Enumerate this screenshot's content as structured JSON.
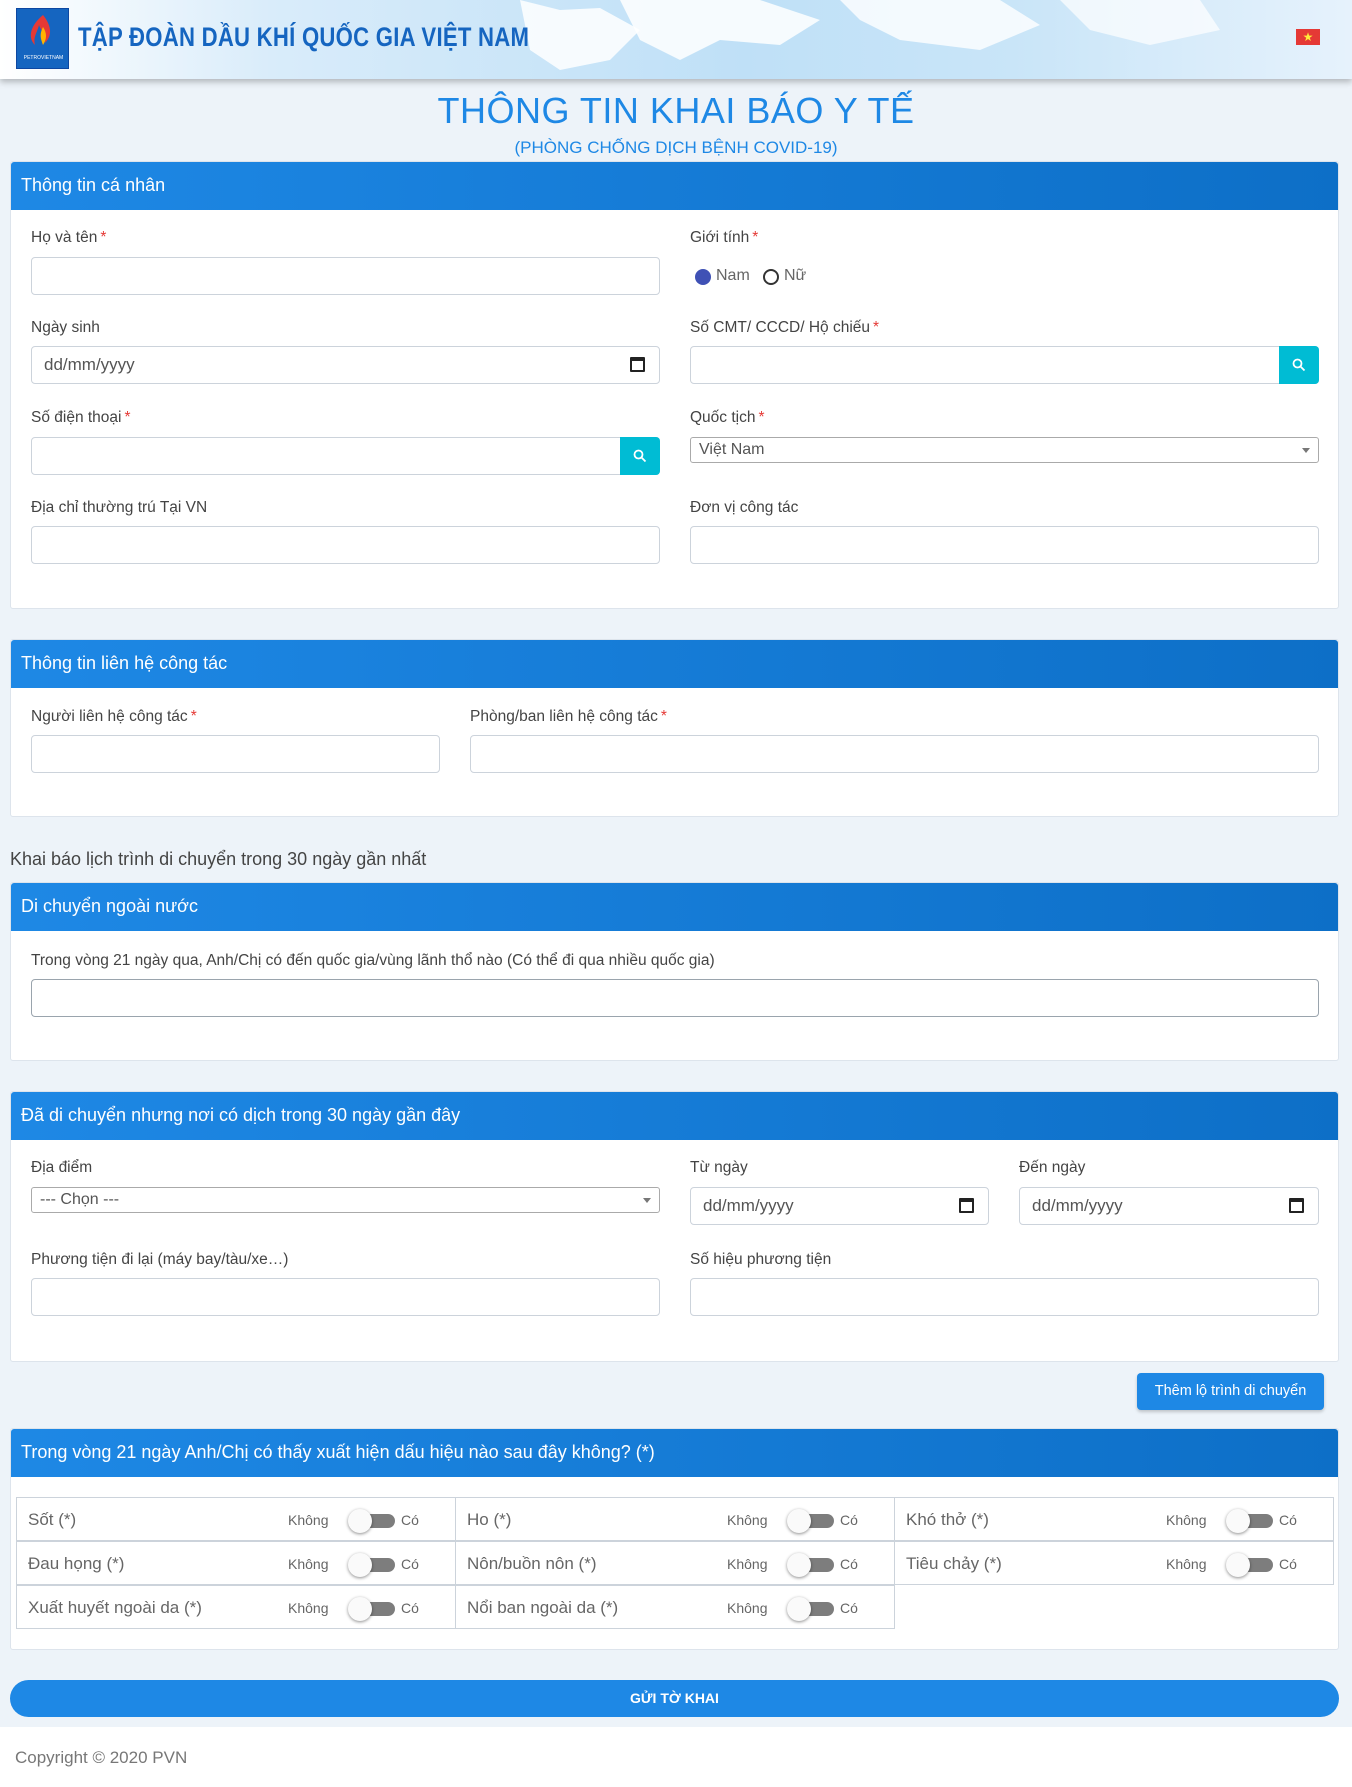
{
  "header": {
    "org_name": "TẬP ĐOÀN DẦU KHÍ QUỐC GIA VIỆT NAM",
    "logo_text": "PETROVIETNAM",
    "flag_icon": "vietnam-flag-icon"
  },
  "page": {
    "title": "THÔNG TIN KHAI BÁO Y TẾ",
    "subtitle": "(PHÒNG CHỐNG DỊCH BỆNH COVID-19)"
  },
  "personal": {
    "heading": "Thông tin cá nhân",
    "name_label": "Họ và tên",
    "gender_label": "Giới tính",
    "gender_male": "Nam",
    "gender_female": "Nữ",
    "gender_selected": "Nam",
    "dob_label": "Ngày sinh",
    "date_placeholder": "dd/mm/yyyy",
    "id_label": "Số CMT/ CCCD/ Hộ chiếu",
    "phone_label": "Số điện thoại",
    "nationality_label": "Quốc tịch",
    "nationality_value": "Việt Nam",
    "address_label": "Địa chỉ thường trú Tại VN",
    "workplace_label": "Đơn vị công tác",
    "required_mark": "*"
  },
  "contact": {
    "heading": "Thông tin liên hệ công tác",
    "person_label": "Người liên hệ công tác",
    "dept_label": "Phòng/ban liên hệ công tác"
  },
  "travel_note": "Khai báo lịch trình di chuyển trong 30 ngày gần nhất",
  "abroad": {
    "heading": "Di chuyển ngoài nước",
    "question": "Trong vòng 21 ngày qua, Anh/Chị có đến quốc gia/vùng lãnh thổ nào (Có thể đi qua nhiều quốc gia)"
  },
  "epidemic": {
    "heading": "Đã di chuyển nhưng nơi có dịch trong 30 ngày gần đây",
    "place_label": "Địa điểm",
    "place_value": "--- Chọn ---",
    "from_label": "Từ ngày",
    "to_label": "Đến ngày",
    "date_placeholder": "dd/mm/yyyy",
    "vehicle_label": "Phương tiện đi lại (máy bay/tàu/xe…)",
    "vehicle_no_label": "Số hiệu phương tiện",
    "add_button": "Thêm lộ trình di chuyển"
  },
  "symptoms": {
    "heading": "Trong vòng 21 ngày Anh/Chị có thấy xuất hiện dấu hiệu nào sau đây không? (*)",
    "no_label": "Không",
    "yes_label": "Có",
    "items": [
      {
        "name": "Sốt (*)",
        "value": "Không"
      },
      {
        "name": "Ho (*)",
        "value": "Không"
      },
      {
        "name": "Khó thở (*)",
        "value": "Không"
      },
      {
        "name": "Đau họng (*)",
        "value": "Không"
      },
      {
        "name": "Nôn/buồn nôn (*)",
        "value": "Không"
      },
      {
        "name": "Tiêu chảy (*)",
        "value": "Không"
      },
      {
        "name": "Xuất huyết ngoài da (*)",
        "value": "Không"
      },
      {
        "name": "Nổi ban ngoài da (*)",
        "value": "Không"
      }
    ]
  },
  "submit_label": "GỬI TỜ KHAI",
  "footer": {
    "copyright": "Copyright © 2020 PVN"
  },
  "colors": {
    "primary": "#1e88e5",
    "search_button": "#00bcd4",
    "required": "#e53935"
  }
}
